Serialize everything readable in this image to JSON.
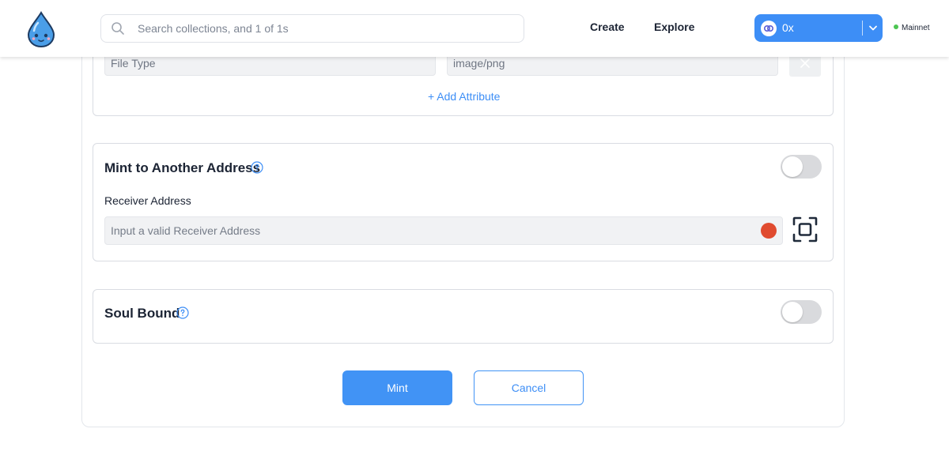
{
  "header": {
    "search_placeholder": "Search collections, and 1 of 1s",
    "nav": {
      "create": "Create",
      "explore": "Explore"
    },
    "wallet": {
      "address": "0x"
    },
    "network": {
      "label": "Mainnet",
      "status_color": "#4cc552"
    }
  },
  "attributes": {
    "rows": [
      {
        "key": "File Type",
        "value": "image/png"
      }
    ],
    "add_label": "+ Add Attribute"
  },
  "mint_to_address": {
    "title": "Mint to Another Address",
    "enabled": false,
    "receiver_label": "Receiver Address",
    "receiver_placeholder": "Input a valid Receiver Address",
    "receiver_value": "",
    "status_color": "#e04b2f"
  },
  "soul_bound": {
    "title": "Soul Bound",
    "enabled": false
  },
  "actions": {
    "mint": "Mint",
    "cancel": "Cancel"
  },
  "colors": {
    "accent": "#3d8ef6",
    "error": "#e04b2f",
    "online": "#4cc552"
  },
  "icons": [
    "water-drop-logo-icon",
    "search-icon",
    "wallet-link-icon",
    "chevron-down-icon",
    "close-icon",
    "help-icon",
    "scan-qr-icon"
  ]
}
